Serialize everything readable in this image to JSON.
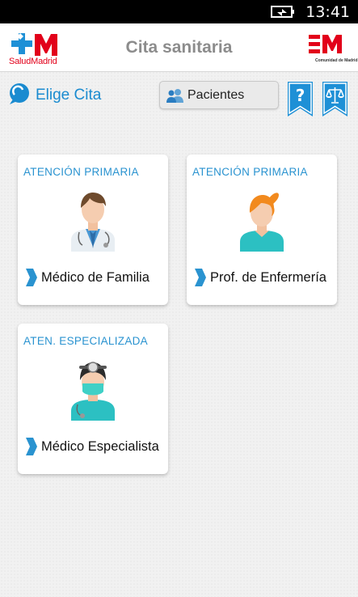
{
  "status_bar": {
    "time": "13:41"
  },
  "header": {
    "title": "Cita sanitaria",
    "left_logo_text": "SaludMadrid",
    "right_logo_text": "Comunidad de Madrid"
  },
  "toolbar": {
    "elige_label": "Elige Cita",
    "pacientes_label": "Pacientes",
    "help_icon": "question-mark",
    "legal_icon": "scales"
  },
  "cards": [
    {
      "category": "ATENCIÓN PRIMARIA",
      "label": "Médico de Familia",
      "icon": "male-doctor"
    },
    {
      "category": "ATENCIÓN PRIMARIA",
      "label": "Prof. de Enfermería",
      "icon": "female-nurse"
    },
    {
      "category": "ATEN. ESPECIALIZADA",
      "label": "Médico Especialista",
      "icon": "specialist-doctor"
    }
  ],
  "colors": {
    "accent_blue": "#1a8bd0",
    "brand_red": "#e2001a",
    "ribbon_blue": "#1e90d6"
  }
}
